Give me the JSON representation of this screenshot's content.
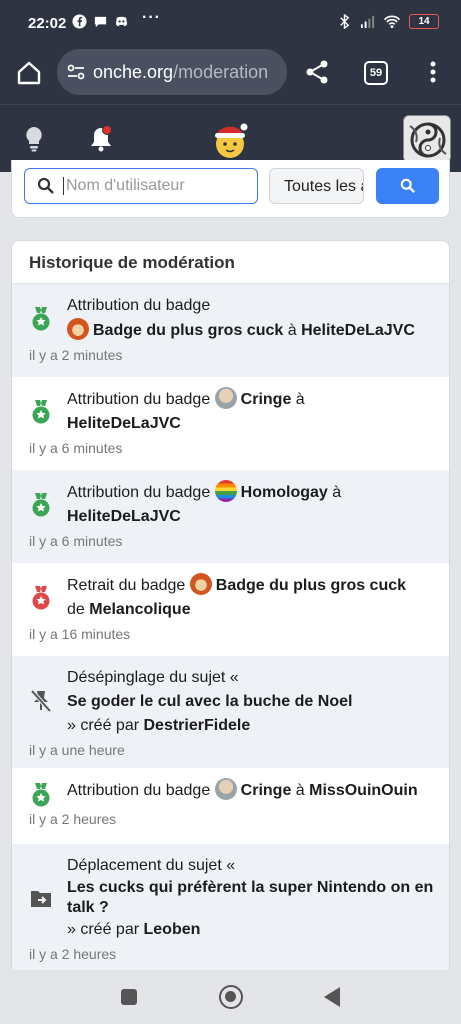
{
  "status_bar": {
    "time": "22:02",
    "battery": "14"
  },
  "browser": {
    "url_domain": "onche.org",
    "url_path": "/moderation",
    "tab_count": "59"
  },
  "search": {
    "placeholder": "Nom d'utilisateur",
    "filter_value": "Toutes les actions"
  },
  "history": {
    "title": "Historique de modération",
    "entries": [
      {
        "text1": "Attribution du badge",
        "badge": "Badge du plus gros cuck",
        "text2": "à",
        "user": "HeliteDeLaJVC",
        "time": "il y a 2 minutes"
      },
      {
        "text1": "Attribution du badge",
        "badge": "Cringe",
        "text2": "à",
        "user": "HeliteDeLaJVC",
        "time": "il y a 6 minutes"
      },
      {
        "text1": "Attribution du badge",
        "badge": "Homologay",
        "text2": "à",
        "user": "HeliteDeLaJVC",
        "time": "il y a 6 minutes"
      },
      {
        "text1": "Retrait du badge",
        "badge": "Badge du plus gros cuck",
        "text2": "de",
        "user": "Melancolique",
        "time": "il y a 16 minutes"
      },
      {
        "text1": "Désépinglage du sujet «",
        "subject": "Se goder le cul avec la buche de Noel",
        "text2": "» créé par",
        "user": "DestrierFidele",
        "time": "il y a une heure"
      },
      {
        "text1": "Attribution du badge",
        "badge": "Cringe",
        "text2": "à",
        "user": "MissOuinOuin",
        "time": "il y a 2 heures"
      },
      {
        "text1": "Déplacement du sujet «",
        "subject": "Les cucks qui préfèrent la super Nintendo on en talk ?",
        "text2": "» créé par",
        "user": "Leoben",
        "time": "il y a 2 heures"
      }
    ]
  },
  "colors": {
    "topbar": "#2e3441",
    "accent": "#3b82f6",
    "badge_green": "#3aa655",
    "badge_red": "#e04848"
  }
}
